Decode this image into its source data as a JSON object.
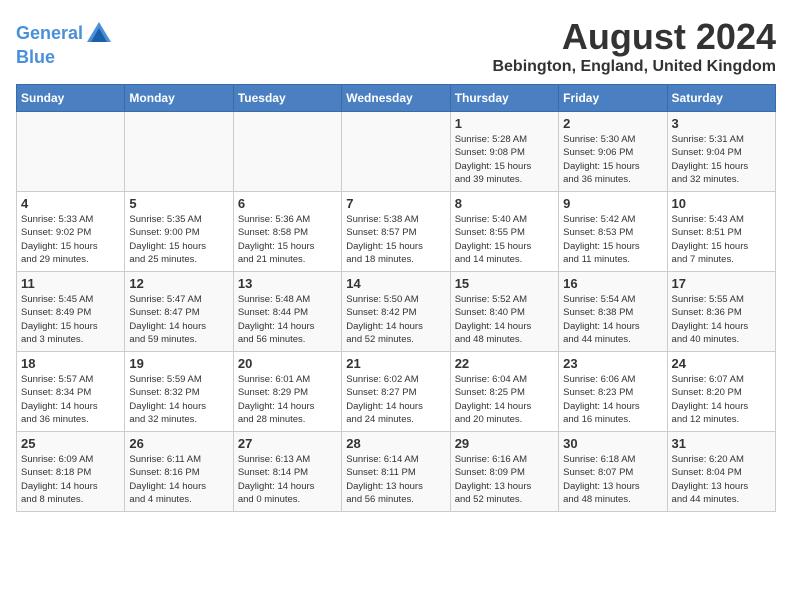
{
  "header": {
    "logo_line1": "General",
    "logo_line2": "Blue",
    "title": "August 2024",
    "subtitle": "Bebington, England, United Kingdom"
  },
  "days_of_week": [
    "Sunday",
    "Monday",
    "Tuesday",
    "Wednesday",
    "Thursday",
    "Friday",
    "Saturday"
  ],
  "weeks": [
    [
      {
        "day": "",
        "info": ""
      },
      {
        "day": "",
        "info": ""
      },
      {
        "day": "",
        "info": ""
      },
      {
        "day": "",
        "info": ""
      },
      {
        "day": "1",
        "info": "Sunrise: 5:28 AM\nSunset: 9:08 PM\nDaylight: 15 hours\nand 39 minutes."
      },
      {
        "day": "2",
        "info": "Sunrise: 5:30 AM\nSunset: 9:06 PM\nDaylight: 15 hours\nand 36 minutes."
      },
      {
        "day": "3",
        "info": "Sunrise: 5:31 AM\nSunset: 9:04 PM\nDaylight: 15 hours\nand 32 minutes."
      }
    ],
    [
      {
        "day": "4",
        "info": "Sunrise: 5:33 AM\nSunset: 9:02 PM\nDaylight: 15 hours\nand 29 minutes."
      },
      {
        "day": "5",
        "info": "Sunrise: 5:35 AM\nSunset: 9:00 PM\nDaylight: 15 hours\nand 25 minutes."
      },
      {
        "day": "6",
        "info": "Sunrise: 5:36 AM\nSunset: 8:58 PM\nDaylight: 15 hours\nand 21 minutes."
      },
      {
        "day": "7",
        "info": "Sunrise: 5:38 AM\nSunset: 8:57 PM\nDaylight: 15 hours\nand 18 minutes."
      },
      {
        "day": "8",
        "info": "Sunrise: 5:40 AM\nSunset: 8:55 PM\nDaylight: 15 hours\nand 14 minutes."
      },
      {
        "day": "9",
        "info": "Sunrise: 5:42 AM\nSunset: 8:53 PM\nDaylight: 15 hours\nand 11 minutes."
      },
      {
        "day": "10",
        "info": "Sunrise: 5:43 AM\nSunset: 8:51 PM\nDaylight: 15 hours\nand 7 minutes."
      }
    ],
    [
      {
        "day": "11",
        "info": "Sunrise: 5:45 AM\nSunset: 8:49 PM\nDaylight: 15 hours\nand 3 minutes."
      },
      {
        "day": "12",
        "info": "Sunrise: 5:47 AM\nSunset: 8:47 PM\nDaylight: 14 hours\nand 59 minutes."
      },
      {
        "day": "13",
        "info": "Sunrise: 5:48 AM\nSunset: 8:44 PM\nDaylight: 14 hours\nand 56 minutes."
      },
      {
        "day": "14",
        "info": "Sunrise: 5:50 AM\nSunset: 8:42 PM\nDaylight: 14 hours\nand 52 minutes."
      },
      {
        "day": "15",
        "info": "Sunrise: 5:52 AM\nSunset: 8:40 PM\nDaylight: 14 hours\nand 48 minutes."
      },
      {
        "day": "16",
        "info": "Sunrise: 5:54 AM\nSunset: 8:38 PM\nDaylight: 14 hours\nand 44 minutes."
      },
      {
        "day": "17",
        "info": "Sunrise: 5:55 AM\nSunset: 8:36 PM\nDaylight: 14 hours\nand 40 minutes."
      }
    ],
    [
      {
        "day": "18",
        "info": "Sunrise: 5:57 AM\nSunset: 8:34 PM\nDaylight: 14 hours\nand 36 minutes."
      },
      {
        "day": "19",
        "info": "Sunrise: 5:59 AM\nSunset: 8:32 PM\nDaylight: 14 hours\nand 32 minutes."
      },
      {
        "day": "20",
        "info": "Sunrise: 6:01 AM\nSunset: 8:29 PM\nDaylight: 14 hours\nand 28 minutes."
      },
      {
        "day": "21",
        "info": "Sunrise: 6:02 AM\nSunset: 8:27 PM\nDaylight: 14 hours\nand 24 minutes."
      },
      {
        "day": "22",
        "info": "Sunrise: 6:04 AM\nSunset: 8:25 PM\nDaylight: 14 hours\nand 20 minutes."
      },
      {
        "day": "23",
        "info": "Sunrise: 6:06 AM\nSunset: 8:23 PM\nDaylight: 14 hours\nand 16 minutes."
      },
      {
        "day": "24",
        "info": "Sunrise: 6:07 AM\nSunset: 8:20 PM\nDaylight: 14 hours\nand 12 minutes."
      }
    ],
    [
      {
        "day": "25",
        "info": "Sunrise: 6:09 AM\nSunset: 8:18 PM\nDaylight: 14 hours\nand 8 minutes."
      },
      {
        "day": "26",
        "info": "Sunrise: 6:11 AM\nSunset: 8:16 PM\nDaylight: 14 hours\nand 4 minutes."
      },
      {
        "day": "27",
        "info": "Sunrise: 6:13 AM\nSunset: 8:14 PM\nDaylight: 14 hours\nand 0 minutes."
      },
      {
        "day": "28",
        "info": "Sunrise: 6:14 AM\nSunset: 8:11 PM\nDaylight: 13 hours\nand 56 minutes."
      },
      {
        "day": "29",
        "info": "Sunrise: 6:16 AM\nSunset: 8:09 PM\nDaylight: 13 hours\nand 52 minutes."
      },
      {
        "day": "30",
        "info": "Sunrise: 6:18 AM\nSunset: 8:07 PM\nDaylight: 13 hours\nand 48 minutes."
      },
      {
        "day": "31",
        "info": "Sunrise: 6:20 AM\nSunset: 8:04 PM\nDaylight: 13 hours\nand 44 minutes."
      }
    ]
  ]
}
